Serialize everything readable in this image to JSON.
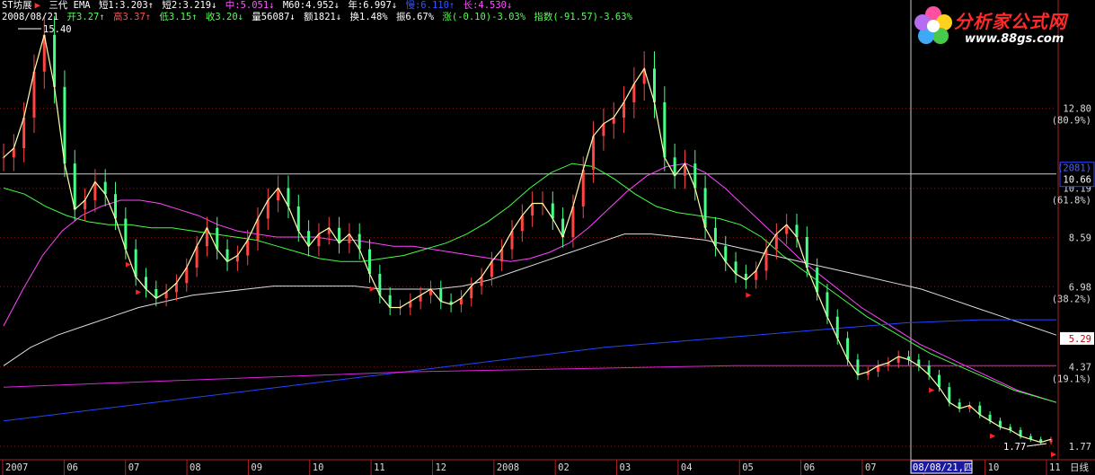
{
  "header_line1": {
    "stock": "ST坊展",
    "indicator": "三代 EMA",
    "items": [
      {
        "text": "短1:3.203↑",
        "color": "#ffffff"
      },
      {
        "text": "短2:3.219↓",
        "color": "#ffffff"
      },
      {
        "text": "中:5.051↓",
        "color": "#ff55ff"
      },
      {
        "text": "M60:4.952↓",
        "color": "#ffffff"
      },
      {
        "text": "年:6.997↓",
        "color": "#ffffff"
      },
      {
        "text": "慢:6.110↑",
        "color": "#3355ff"
      },
      {
        "text": "长:4.530↓",
        "color": "#ff55ff"
      }
    ]
  },
  "header_line2": {
    "date": "2008/08/21",
    "items": [
      {
        "text": "开3.27↑",
        "color": "#55ff55"
      },
      {
        "text": "高3.37↑",
        "color": "#ff5555"
      },
      {
        "text": "低3.15↑",
        "color": "#55ff55"
      },
      {
        "text": "收3.20↓",
        "color": "#55ff55"
      },
      {
        "text": "量56087↓",
        "color": "#ffffff"
      },
      {
        "text": "额1821↓",
        "color": "#ffffff"
      },
      {
        "text": "换1.48%",
        "color": "#ffffff"
      },
      {
        "text": "振6.67%",
        "color": "#ffffff"
      },
      {
        "text": "涨(-0.10)-3.03%",
        "color": "#55ff55"
      },
      {
        "text": "指数(-91.57)-3.63%",
        "color": "#55ff55"
      }
    ]
  },
  "logo": {
    "name": "分析家公式网",
    "url": "www.88gs.com"
  },
  "chart_data": {
    "type": "line",
    "ylim": [
      1.77,
      15.4
    ],
    "y_ticks": [
      {
        "value": 12.8,
        "label": "12.80",
        "pct": "(80.9%)"
      },
      {
        "value": 10.19,
        "label": "10.19",
        "pct": "(61.8%)"
      },
      {
        "value": 8.59,
        "label": "8.59",
        "pct": ""
      },
      {
        "value": 6.98,
        "label": "6.98",
        "pct": "(38.2%)"
      },
      {
        "value": 4.37,
        "label": "4.37",
        "pct": "(19.1%)"
      },
      {
        "value": 1.77,
        "label": "1.77",
        "pct": ""
      }
    ],
    "crosshair": {
      "value": 10.66,
      "label": "10.66",
      "count_label": "(2081)",
      "date_label": "08/08/21,四"
    },
    "last_price": {
      "value": 5.29,
      "label": "5.29"
    },
    "max_label": "15.40",
    "min_label": "1.77",
    "x_labels": [
      "2007",
      "06",
      "07",
      "08",
      "09",
      "10",
      "11",
      "12",
      "2008",
      "02",
      "03",
      "04",
      "05",
      "06",
      "07",
      "08",
      "10",
      "11"
    ],
    "period_label": "日线",
    "price": [
      11.2,
      11.5,
      12.5,
      14.0,
      15.2,
      13.5,
      11.0,
      9.5,
      9.8,
      10.4,
      10.0,
      9.2,
      8.2,
      7.3,
      6.9,
      6.6,
      6.8,
      7.1,
      7.6,
      8.3,
      8.9,
      8.2,
      7.8,
      8.0,
      8.5,
      9.2,
      9.8,
      10.2,
      9.6,
      8.8,
      8.3,
      8.7,
      8.9,
      8.4,
      8.7,
      8.2,
      7.4,
      6.7,
      6.3,
      6.3,
      6.5,
      6.7,
      6.9,
      6.5,
      6.4,
      6.6,
      7.0,
      7.3,
      7.8,
      8.2,
      8.8,
      9.3,
      9.7,
      9.7,
      9.2,
      8.6,
      9.6,
      10.8,
      11.9,
      12.3,
      12.5,
      13.0,
      13.6,
      14.1,
      13.0,
      11.2,
      10.6,
      11.0,
      10.2,
      8.9,
      8.3,
      7.8,
      7.4,
      7.2,
      7.5,
      8.2,
      8.7,
      9.0,
      8.6,
      7.6,
      6.8,
      6.0,
      5.3,
      4.6,
      4.1,
      4.2,
      4.4,
      4.5,
      4.7,
      4.6,
      4.4,
      4.1,
      3.7,
      3.2,
      3.0,
      3.1,
      2.8,
      2.6,
      2.4,
      2.3,
      2.1,
      2.0,
      1.9,
      2.0
    ],
    "series": [
      {
        "color": "#ff44ff",
        "values": [
          5.7,
          6.9,
          8.0,
          8.8,
          9.3,
          9.6,
          9.8,
          9.8,
          9.7,
          9.5,
          9.3,
          9.0,
          8.8,
          8.7,
          8.6,
          8.6,
          8.6,
          8.5,
          8.5,
          8.4,
          8.3,
          8.3,
          8.2,
          8.1,
          8.0,
          7.9,
          7.8,
          7.9,
          8.1,
          8.4,
          8.9,
          9.5,
          10.1,
          10.6,
          10.9,
          11.0,
          10.7,
          10.2,
          9.6,
          9.0,
          8.4,
          7.8,
          7.3,
          6.8,
          6.3,
          5.9,
          5.5,
          5.1,
          4.8,
          4.5,
          4.2,
          3.9,
          3.6,
          3.4,
          3.2
        ]
      },
      {
        "color": "#44ff44",
        "values": [
          10.2,
          10.0,
          9.6,
          9.3,
          9.1,
          9.0,
          9.0,
          8.9,
          8.9,
          8.8,
          8.7,
          8.6,
          8.5,
          8.3,
          8.1,
          7.9,
          7.8,
          7.8,
          7.9,
          8.0,
          8.2,
          8.4,
          8.7,
          9.1,
          9.6,
          10.2,
          10.7,
          11.0,
          10.9,
          10.5,
          10.0,
          9.6,
          9.4,
          9.3,
          9.2,
          9.0,
          8.6,
          8.0,
          7.5,
          7.0,
          6.5,
          6.0,
          5.6,
          5.2,
          4.8,
          4.5,
          4.2,
          3.9,
          3.6,
          3.4,
          3.2
        ]
      },
      {
        "color": "#dddddd",
        "values": [
          4.4,
          5.0,
          5.4,
          5.7,
          6.0,
          6.3,
          6.5,
          6.7,
          6.8,
          6.9,
          7.0,
          7.0,
          7.0,
          7.0,
          6.9,
          6.9,
          6.9,
          7.0,
          7.2,
          7.5,
          7.8,
          8.1,
          8.4,
          8.7,
          8.7,
          8.6,
          8.5,
          8.3,
          8.1,
          7.9,
          7.7,
          7.5,
          7.3,
          7.1,
          6.9,
          6.6,
          6.3,
          6.0,
          5.7,
          5.4
        ]
      },
      {
        "color": "#2244ff",
        "values": [
          2.6,
          2.9,
          3.2,
          3.5,
          3.8,
          4.1,
          4.4,
          4.7,
          5.0,
          5.2,
          5.4,
          5.6,
          5.8,
          5.9,
          5.9
        ]
      },
      {
        "color": "#dd22dd",
        "values": [
          3.7,
          3.8,
          3.9,
          4.0,
          4.1,
          4.2,
          4.25,
          4.3,
          4.35,
          4.4,
          4.4,
          4.4,
          4.4,
          4.4
        ]
      }
    ],
    "signal_markers": [
      12,
      13,
      36,
      73,
      91,
      97,
      103
    ]
  }
}
